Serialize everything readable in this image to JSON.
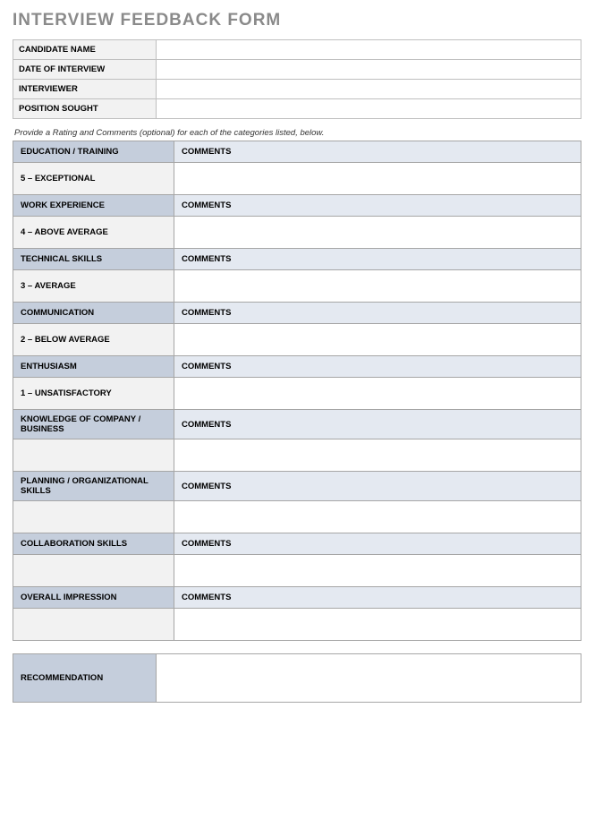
{
  "title": "INTERVIEW FEEDBACK FORM",
  "info": {
    "fields": [
      {
        "label": "CANDIDATE NAME",
        "value": ""
      },
      {
        "label": "DATE OF INTERVIEW",
        "value": ""
      },
      {
        "label": "INTERVIEWER",
        "value": ""
      },
      {
        "label": "POSITION SOUGHT",
        "value": ""
      }
    ]
  },
  "instruction": "Provide a Rating and Comments (optional) for each of the categories listed, below.",
  "comments_label": "COMMENTS",
  "categories": [
    {
      "name": "EDUCATION / TRAINING",
      "rating": "5 – EXCEPTIONAL",
      "comment": ""
    },
    {
      "name": "WORK EXPERIENCE",
      "rating": "4 – ABOVE AVERAGE",
      "comment": ""
    },
    {
      "name": "TECHNICAL SKILLS",
      "rating": "3 – AVERAGE",
      "comment": ""
    },
    {
      "name": "COMMUNICATION",
      "rating": "2 – BELOW AVERAGE",
      "comment": ""
    },
    {
      "name": "ENTHUSIASM",
      "rating": "1 – UNSATISFACTORY",
      "comment": ""
    },
    {
      "name": "KNOWLEDGE OF COMPANY / BUSINESS",
      "rating": "",
      "comment": ""
    },
    {
      "name": "PLANNING / ORGANIZATIONAL SKILLS",
      "rating": "",
      "comment": ""
    },
    {
      "name": "COLLABORATION SKILLS",
      "rating": "",
      "comment": ""
    },
    {
      "name": "OVERALL IMPRESSION",
      "rating": "",
      "comment": ""
    }
  ],
  "recommendation": {
    "label": "RECOMMENDATION",
    "value": ""
  }
}
